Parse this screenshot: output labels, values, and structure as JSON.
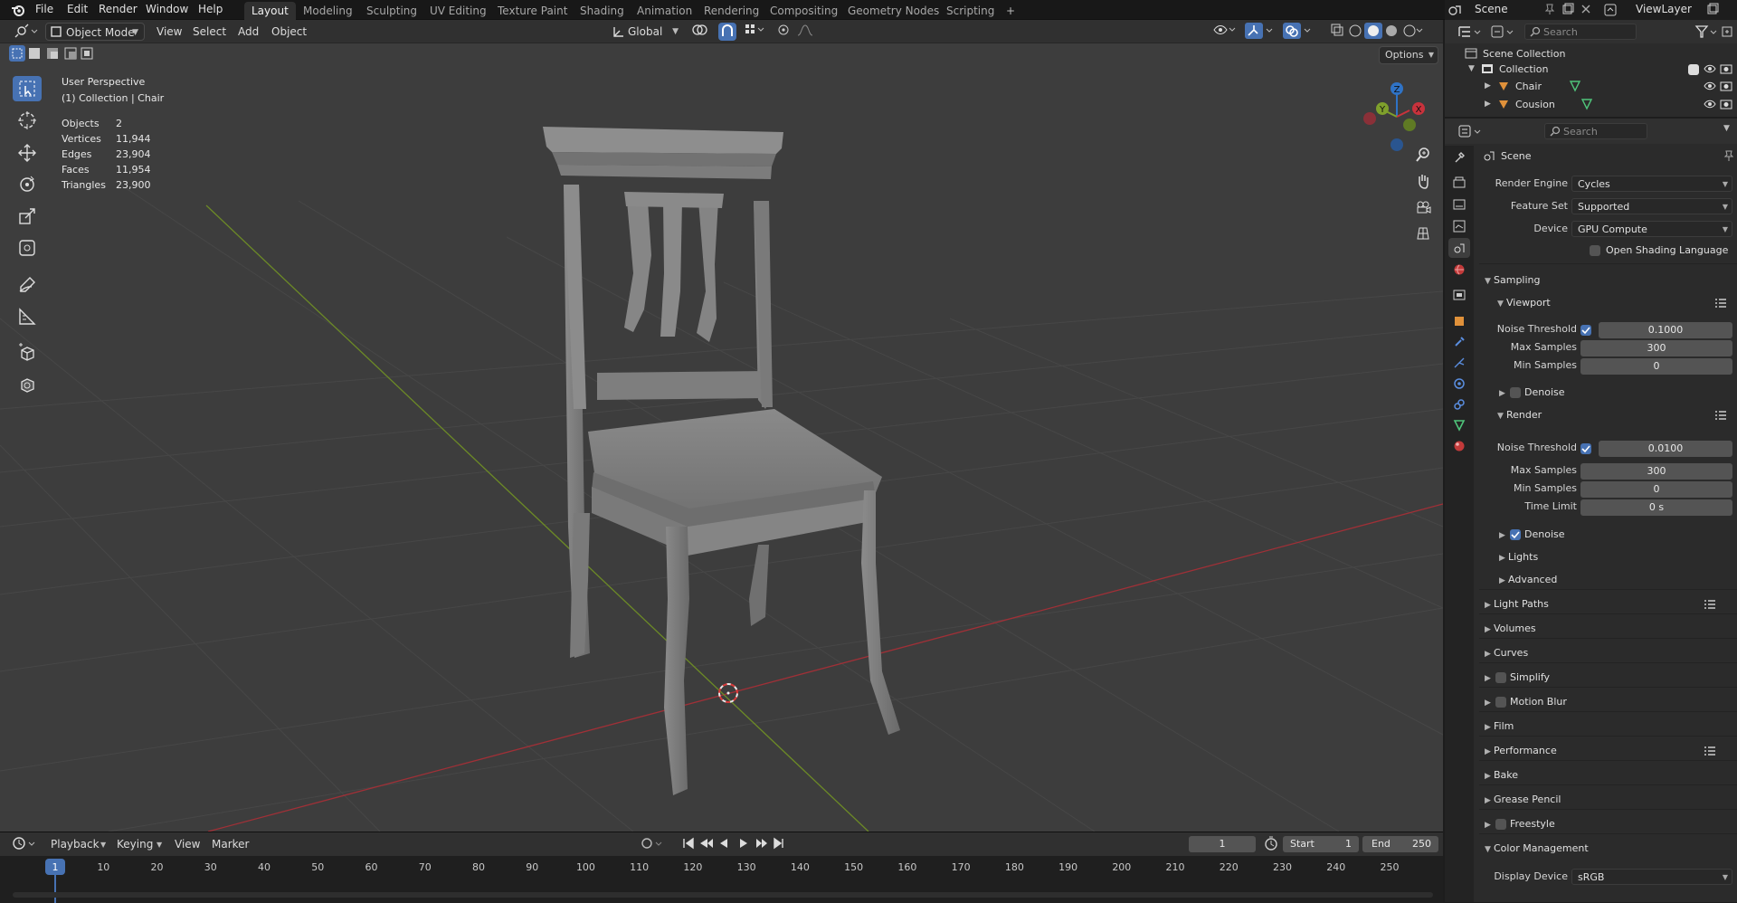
{
  "topbar": {
    "menus": [
      "File",
      "Edit",
      "Render",
      "Window",
      "Help"
    ],
    "workspaces": [
      "Layout",
      "Modeling",
      "Sculpting",
      "UV Editing",
      "Texture Paint",
      "Shading",
      "Animation",
      "Rendering",
      "Compositing",
      "Geometry Nodes",
      "Scripting"
    ],
    "active_workspace": "Layout",
    "add_tab": "+",
    "scene_name": "Scene",
    "view_layer": "ViewLayer"
  },
  "viewport": {
    "mode": "Object Mode",
    "menus": [
      "View",
      "Select",
      "Add",
      "Object"
    ],
    "transform_orientation": "Global",
    "options_label": "Options",
    "overlay_title": "User Perspective",
    "overlay_subtitle": "(1) Collection | Chair",
    "stats": [
      {
        "label": "Objects",
        "value": "2"
      },
      {
        "label": "Vertices",
        "value": "11,944"
      },
      {
        "label": "Edges",
        "value": "23,904"
      },
      {
        "label": "Faces",
        "value": "11,954"
      },
      {
        "label": "Triangles",
        "value": "23,900"
      }
    ],
    "gizmo_axes": {
      "z": "Z",
      "y": "Y",
      "x": "X"
    },
    "colors": {
      "x_axis": "#c8323c",
      "y_axis": "#7fa02c",
      "z_axis": "#2f73c6",
      "grid": "#474747",
      "bg": "#3d3d3d",
      "active_tool": "#4772b3"
    }
  },
  "timeline": {
    "menus": [
      "Playback",
      "Keying",
      "View",
      "Marker"
    ],
    "current_frame": "1",
    "start_label": "Start",
    "start_value": "1",
    "end_label": "End",
    "end_value": "250",
    "ticks": [
      "1",
      "10",
      "20",
      "30",
      "40",
      "50",
      "60",
      "70",
      "80",
      "90",
      "100",
      "110",
      "120",
      "130",
      "140",
      "150",
      "160",
      "170",
      "180",
      "190",
      "200",
      "210",
      "220",
      "230",
      "240",
      "250"
    ]
  },
  "outliner": {
    "search_placeholder": "Search",
    "root": "Scene Collection",
    "collection": "Collection",
    "items": [
      "Chair",
      "Cousion"
    ]
  },
  "properties": {
    "search_placeholder": "Search",
    "context": "Scene",
    "render_engine_label": "Render Engine",
    "render_engine": "Cycles",
    "feature_set_label": "Feature Set",
    "feature_set": "Supported",
    "device_label": "Device",
    "device": "GPU Compute",
    "osl_label": "Open Shading Language",
    "sampling": "Sampling",
    "viewport": "Viewport",
    "noise_threshold_label": "Noise Threshold",
    "vp_noise_threshold": "0.1000",
    "max_samples_label": "Max Samples",
    "vp_max_samples": "300",
    "min_samples_label": "Min Samples",
    "vp_min_samples": "0",
    "denoise_label": "Denoise",
    "render": "Render",
    "r_noise_threshold": "0.0100",
    "r_max_samples": "300",
    "r_min_samples": "0",
    "time_limit_label": "Time Limit",
    "time_limit": "0 s",
    "lights": "Lights",
    "advanced": "Advanced",
    "light_paths": "Light Paths",
    "volumes": "Volumes",
    "curves": "Curves",
    "simplify": "Simplify",
    "motion_blur": "Motion Blur",
    "film": "Film",
    "performance": "Performance",
    "bake": "Bake",
    "grease_pencil": "Grease Pencil",
    "freestyle": "Freestyle",
    "color_management": "Color Management",
    "display_device_label": "Display Device",
    "display_device": "sRGB"
  }
}
